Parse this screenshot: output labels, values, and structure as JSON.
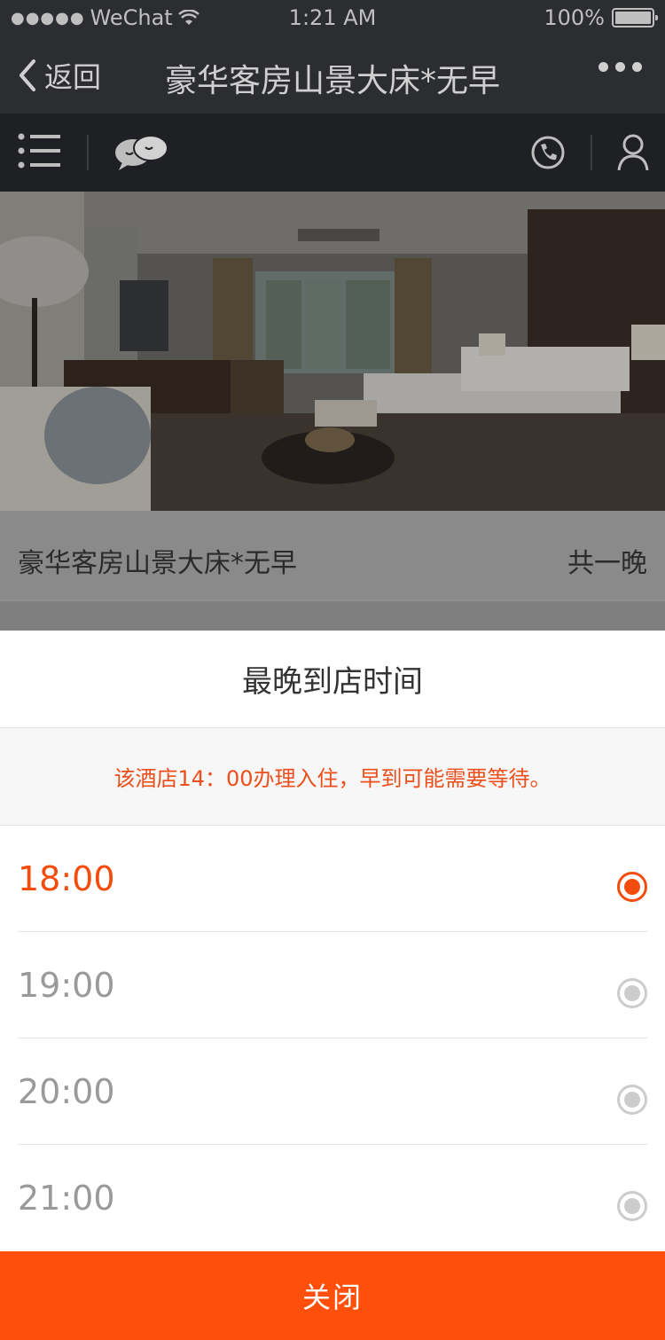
{
  "status_bar": {
    "carrier": "WeChat",
    "time": "1:21 AM",
    "battery": "100%"
  },
  "nav": {
    "back_label": "返回",
    "title": "豪华客房山景大床*无早"
  },
  "room": {
    "name": "豪华客房山景大床*无早",
    "nights": "共一晚"
  },
  "sheet": {
    "title": "最晚到店时间",
    "notice": "该酒店14：00办理入住，早到可能需要等待。",
    "options": [
      {
        "label": "18:00",
        "selected": true
      },
      {
        "label": "19:00",
        "selected": false
      },
      {
        "label": "20:00",
        "selected": false
      },
      {
        "label": "21:00",
        "selected": false
      }
    ],
    "close_label": "关闭"
  },
  "colors": {
    "accent": "#ff4f0a",
    "selected_text": "#f34c0c",
    "notice_text": "#ec4f1c"
  }
}
